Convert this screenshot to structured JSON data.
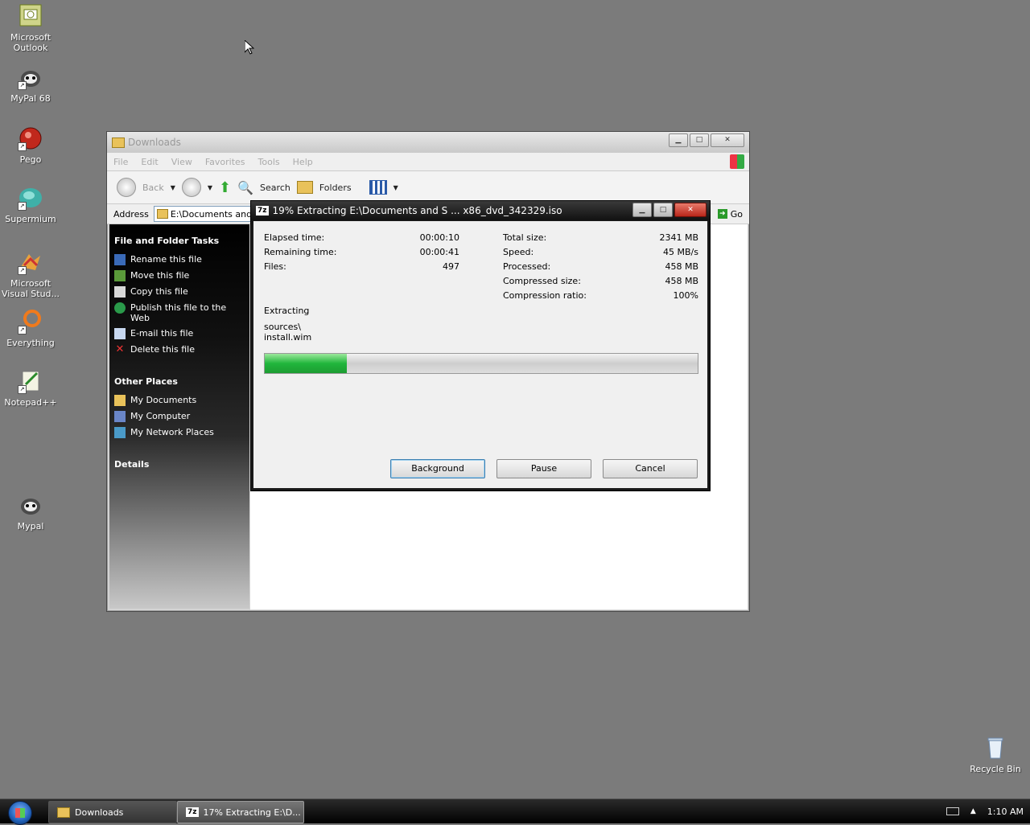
{
  "desktop": {
    "icons": [
      {
        "label": "Microsoft Outlook",
        "icon": "outlook-icon"
      },
      {
        "label": "MyPal 68",
        "icon": "mypal-icon"
      },
      {
        "label": "Pego",
        "icon": "pego-icon"
      },
      {
        "label": "Supermium",
        "icon": "supermium-icon"
      },
      {
        "label": "Microsoft Visual Stud...",
        "icon": "visual-studio-icon"
      },
      {
        "label": "Everything",
        "icon": "everything-icon"
      },
      {
        "label": "Notepad++",
        "icon": "notepadpp-icon"
      },
      {
        "label": "Mypal",
        "icon": "mypal-icon"
      },
      {
        "label": "Recycle Bin",
        "icon": "recycle-bin-icon"
      }
    ]
  },
  "explorer": {
    "title": "Downloads",
    "menu": [
      "File",
      "Edit",
      "View",
      "Favorites",
      "Tools",
      "Help"
    ],
    "toolbar": {
      "back": "Back",
      "search": "Search",
      "folders": "Folders"
    },
    "address": {
      "label": "Address",
      "value": "E:\\Documents and S",
      "go": "Go"
    },
    "tasks": {
      "file_folder_title": "File and Folder Tasks",
      "file_folder_items": [
        "Rename this file",
        "Move this file",
        "Copy this file",
        "Publish this file to the Web",
        "E-mail this file",
        "Delete this file"
      ],
      "other_places_title": "Other Places",
      "other_places_items": [
        "My Documents",
        "My Computer",
        "My Network Places"
      ],
      "details_title": "Details"
    }
  },
  "dialog": {
    "title": "19% Extracting E:\\Documents and S ... x86_dvd_342329.iso",
    "left": [
      {
        "label": "Elapsed time:",
        "value": "00:00:10"
      },
      {
        "label": "Remaining time:",
        "value": "00:00:41"
      },
      {
        "label": "Files:",
        "value": "497"
      }
    ],
    "right": [
      {
        "label": "Total size:",
        "value": "2341 MB"
      },
      {
        "label": "Speed:",
        "value": "45 MB/s"
      },
      {
        "label": "Processed:",
        "value": "458 MB"
      },
      {
        "label": "Compressed size:",
        "value": "458 MB"
      },
      {
        "label": "Compression ratio:",
        "value": "100%"
      }
    ],
    "status": "Extracting",
    "path_line1": "sources\\",
    "path_line2": "install.wim",
    "progress_fraction": 0.19,
    "buttons": {
      "background": "Background",
      "pause": "Pause",
      "cancel": "Cancel"
    }
  },
  "taskbar": {
    "items": [
      "Downloads",
      "17% Extracting E:\\D..."
    ],
    "clock": "1:10 AM"
  }
}
